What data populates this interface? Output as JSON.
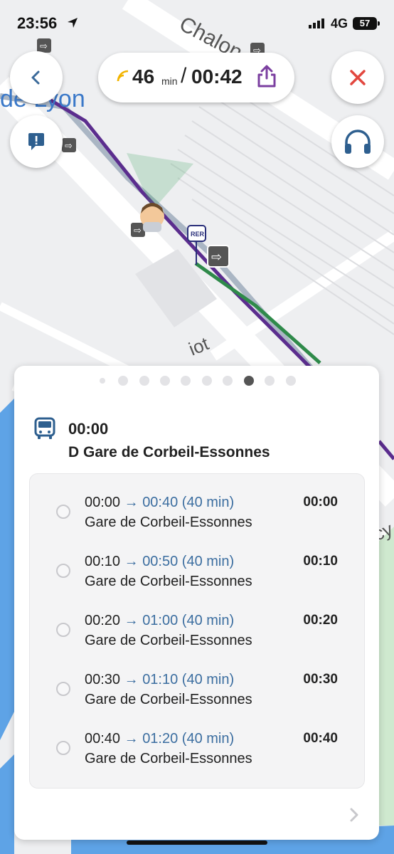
{
  "status_bar": {
    "time": "23:56",
    "network": "4G",
    "battery": "57"
  },
  "map": {
    "labels": {
      "street_top": "Chalon",
      "station": "de Lyon",
      "street_mid": "iot",
      "street_right": "cy"
    },
    "rer_badge": "RER",
    "colors": {
      "line_purple": "#5b2d8e",
      "line_green": "#2f8a4a",
      "line_grey": "#aab6c4",
      "water": "#5ea3e6"
    }
  },
  "nav": {
    "back_icon": "chevron-left-icon",
    "close_icon": "close-icon",
    "report_icon": "report-icon",
    "audio_icon": "headphones-icon",
    "duration": "46",
    "duration_unit": "min",
    "separator": "/",
    "arrival": "00:42",
    "share_icon": "share-icon"
  },
  "panel": {
    "page_count": 10,
    "active_page": 7,
    "icon": "bus-icon",
    "departure_time": "00:00",
    "destination": "D Gare de Corbeil-Essonnes",
    "departures": [
      {
        "depart": "00:00",
        "arrow": "→",
        "arrive": "00:40 (40 min)",
        "stop": "Gare de Corbeil-Essonnes",
        "right_time": "00:00"
      },
      {
        "depart": "00:10",
        "arrow": "→",
        "arrive": "00:50 (40 min)",
        "stop": "Gare de Corbeil-Essonnes",
        "right_time": "00:10"
      },
      {
        "depart": "00:20",
        "arrow": "→",
        "arrive": "01:00 (40 min)",
        "stop": "Gare de Corbeil-Essonnes",
        "right_time": "00:20"
      },
      {
        "depart": "00:30",
        "arrow": "→",
        "arrive": "01:10 (40 min)",
        "stop": "Gare de Corbeil-Essonnes",
        "right_time": "00:30"
      },
      {
        "depart": "00:40",
        "arrow": "→",
        "arrive": "01:20 (40 min)",
        "stop": "Gare de Corbeil-Essonnes",
        "right_time": "00:40"
      }
    ]
  }
}
